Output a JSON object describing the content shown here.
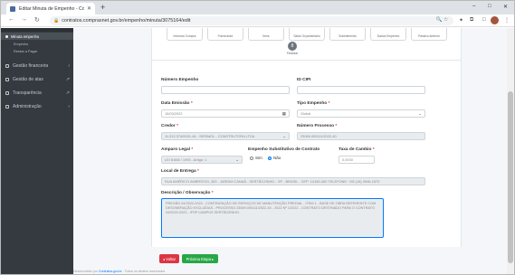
{
  "browser": {
    "tab_title": "Editar Minuta de Empenho - Co",
    "url": "contratos.comprasnet.gov.br/empenho/minuta/3075164/edit",
    "new_tab_symbol": "+",
    "min_symbol": "–",
    "max_symbol": "□",
    "close_symbol": "✕",
    "back_symbol": "←",
    "forward_symbol": "→",
    "reload_symbol": "↻",
    "lock_symbol": "🔒",
    "omni_icons": "🔍 ☆",
    "ext_icon": "✦",
    "puzzle_icon": "⧉",
    "menu_icon": "⋮"
  },
  "sidebar": {
    "active_item": "Minuta empenho",
    "sub_items": [
      "Empenho",
      "Restos a Pagar"
    ],
    "items": [
      {
        "label": "Gestão financeira",
        "arrow": "‹"
      },
      {
        "label": "Gestão de atas",
        "arrow": "↗"
      },
      {
        "label": "Transparência",
        "arrow": "↗"
      },
      {
        "label": "Administração",
        "arrow": "‹"
      }
    ]
  },
  "stepper": {
    "steps": [
      "Informar Compra",
      "Fornecedor",
      "Itens",
      "Saldo Orçamentário",
      "Subelemento",
      "Dados Empenho",
      "Passivo Anterior"
    ],
    "last_step_number": "8",
    "last_step_label": "Finalizar"
  },
  "form": {
    "numero_empenho": {
      "label": "Número Empenho",
      "value": ""
    },
    "id_cipi": {
      "label": "ID CIPI",
      "value": ""
    },
    "data_emissao": {
      "label": "Data Emissão",
      "required": "*",
      "value": "15/03/2022"
    },
    "tipo_empenho": {
      "label": "Tipo Empenho",
      "required": "*",
      "value": "Global"
    },
    "credor": {
      "label": "Credor",
      "required": "*",
      "value": "11.012.374/0001-46 - SERIMOL - CONSTRUTORA LTDA"
    },
    "numero_processo": {
      "label": "Número Processo",
      "required": "*",
      "value": "23069.000111/2022-40"
    },
    "amparo_legal": {
      "label": "Amparo Legal",
      "required": "*",
      "value": "LEI 8.666 / 1993 - Artigo: 1"
    },
    "empenho_substitutivo": {
      "label": "Empenho Substitutivo de Contrato",
      "option_yes": "Sim",
      "option_no": "Não"
    },
    "taxa_cambio": {
      "label": "Taxa de Cambio",
      "required": "*",
      "value": "0,0000"
    },
    "local_entrega": {
      "label": "Local de Entrega",
      "required": "*",
      "value": "RUA AMÉRICO AMBRÓSIO, 269 - JARDIM CANAÃ - SERTÃOZINHO - SP - BRASIL - CEP: 14169-260 TELEFONE: +55 (16) 3946-1570"
    },
    "descricao": {
      "label": "Descrição / Observação",
      "required": "*",
      "value": "PREGÃO 04/2022-2023 - CONTRATAÇÃO DE SERVIÇOS DE MANUTENÇÃO PREDIAL - ITEM 1 - BASE DE OBRA REFERENTE COM DESONERAÇÃO EXCLUÍDAS - PROCESSO 23069.000111/2022-40 - 2022 Nº 1/2022 - CONTRATO DESTINADO PARA O CONTRATO 04/2022-2023 - IFSP CAMPUS SERTÃOZINHO."
    }
  },
  "buttons": {
    "back": "◂ Voltar",
    "next": "Próxima Etapa ▸"
  },
  "footer": {
    "text": "Desenvolvido por",
    "link": "Contratos.gov.br",
    "rest": " - Todos os direitos reservados"
  }
}
